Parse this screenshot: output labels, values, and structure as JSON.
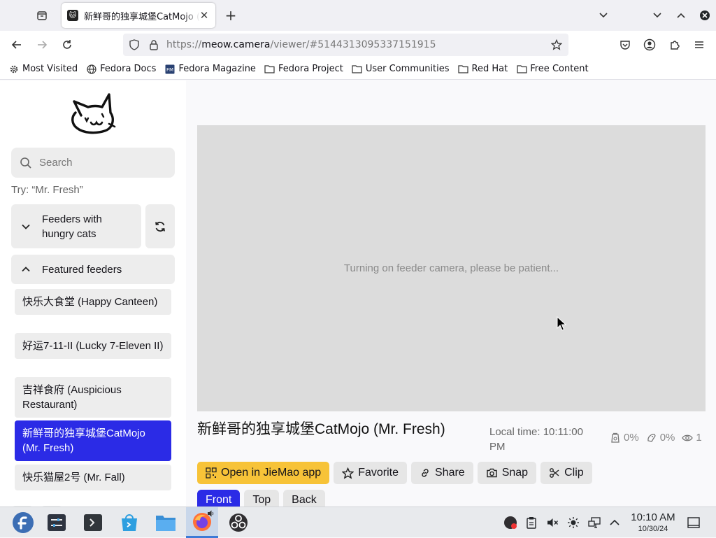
{
  "browser": {
    "tab": {
      "title": "新鲜哥的独享城堡CatMojo (Mr. Fresh) · meow.camera"
    },
    "url": {
      "prefix": "https://",
      "host": "meow.camera",
      "path": "/viewer/#5144313095337151915"
    },
    "bookmarks": [
      {
        "label": "Most Visited",
        "icon": "gear-icon"
      },
      {
        "label": "Fedora Docs",
        "icon": "globe-icon"
      },
      {
        "label": "Fedora Magazine",
        "icon": "fedora-magazine-icon"
      },
      {
        "label": "Fedora Project",
        "icon": "folder-icon"
      },
      {
        "label": "User Communities",
        "icon": "folder-icon"
      },
      {
        "label": "Red Hat",
        "icon": "folder-icon"
      },
      {
        "label": "Free Content",
        "icon": "folder-icon"
      }
    ]
  },
  "sidebar": {
    "search_placeholder": "Search",
    "try_hint": "Try: “Mr. Fresh”",
    "group_hungry": "Feeders with hungry cats",
    "group_featured": "Featured feeders",
    "feeders": [
      {
        "label": "快乐大食堂 (Happy Canteen)",
        "active": false
      },
      {
        "label": "好运7-11-II (Lucky 7-Eleven II)",
        "active": false
      },
      {
        "label": "吉祥食府 (Auspicious Restaurant)",
        "active": false
      },
      {
        "label": "新鲜哥的独享城堡CatMojo (Mr. Fresh)",
        "active": true
      },
      {
        "label": "快乐猫屋2号 (Mr. Fall)",
        "active": false
      }
    ]
  },
  "viewer": {
    "status_message": "Turning on feeder camera, please be patient...",
    "feeder_name": "新鲜哥的独享城堡CatMojo (Mr. Fresh)",
    "local_time": "Local time: 10:11:00 PM",
    "stats": {
      "food": "0%",
      "treats": "0%",
      "viewers": "1"
    },
    "actions": {
      "open_app": "Open in JieMao app",
      "favorite": "Favorite",
      "share": "Share",
      "snap": "Snap",
      "clip": "Clip"
    },
    "cameras": [
      "Front",
      "Top",
      "Back"
    ],
    "active_camera": "Front"
  },
  "taskbar": {
    "time": "10:10 AM",
    "date": "10/30/24"
  },
  "colors": {
    "accent": "#2b2be6",
    "open_app": "#f7c338",
    "video_bg": "#dcdcdc"
  }
}
